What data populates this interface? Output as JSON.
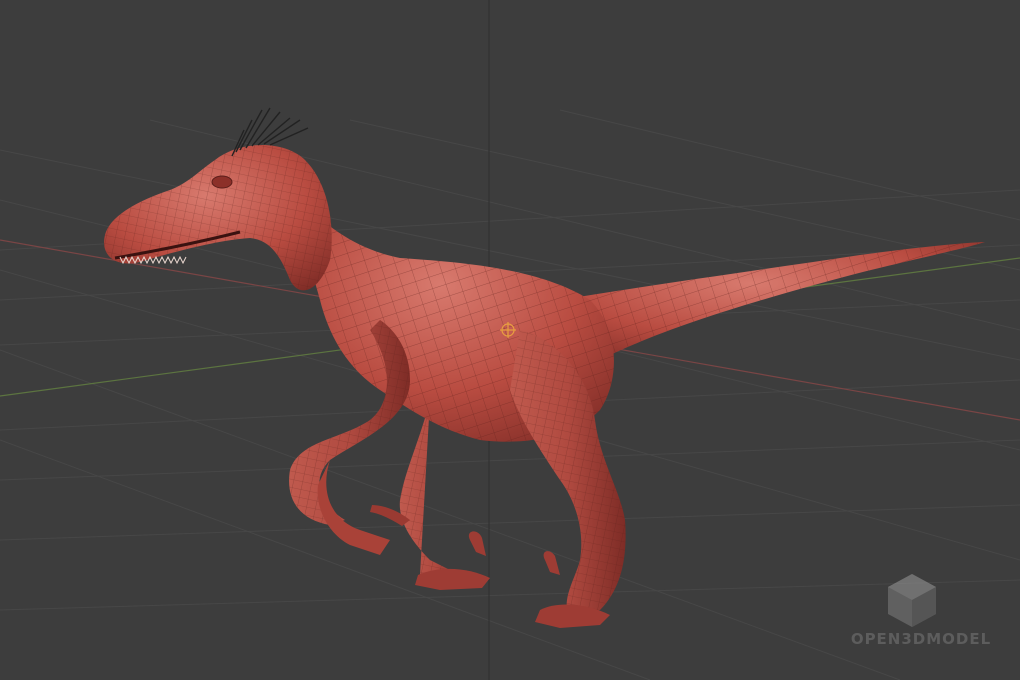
{
  "viewport": {
    "background_color": "#3d3d3d",
    "grid_color": "#484848",
    "x_axis_color": "#8a4848",
    "y_axis_color": "#5f7a3a",
    "z_axis_color": "#4a4a4a"
  },
  "model": {
    "body_color": "#b5493f",
    "shade_color": "#8e332c",
    "highlight_color": "#d9756a",
    "wire_color": "#5a1e1a",
    "quill_color": "#222222"
  },
  "watermark": {
    "text": "OPEN3DMODEL",
    "icon": "cube-logo-icon",
    "color": "#7a7a7a"
  },
  "overlays": {
    "origin_marker": "object-origin-icon"
  }
}
